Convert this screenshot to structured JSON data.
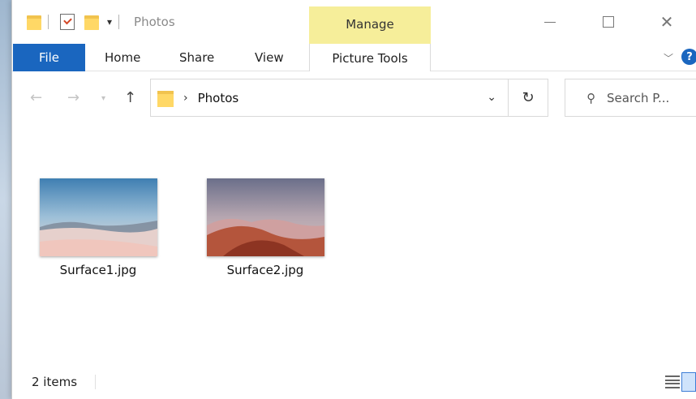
{
  "window": {
    "title": "Photos",
    "contextual_tab_group": "Manage"
  },
  "ribbon": {
    "tabs": [
      {
        "label": "File"
      },
      {
        "label": "Home"
      },
      {
        "label": "Share"
      },
      {
        "label": "View"
      },
      {
        "label": "Picture Tools"
      }
    ],
    "help_label": "?"
  },
  "navigation": {
    "breadcrumb": "Photos",
    "search_placeholder": "Search P..."
  },
  "files": [
    {
      "name": "Surface1.jpg",
      "icon": "image-thumbnail"
    },
    {
      "name": "Surface2.jpg",
      "icon": "image-thumbnail"
    }
  ],
  "status": {
    "item_count": "2 items"
  },
  "colors": {
    "file_tab": "#1a66bf",
    "manage_highlight": "#f6ee9a",
    "folder": "#ffd866"
  }
}
